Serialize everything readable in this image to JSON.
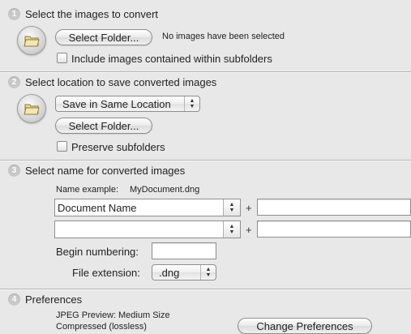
{
  "section1": {
    "number": "1",
    "title": "Select the images to convert",
    "select_folder_label": "Select Folder...",
    "status": "No images have been selected",
    "include_subfolders_label": "Include images contained within subfolders"
  },
  "section2": {
    "number": "2",
    "title": "Select location to save converted images",
    "location_value": "Save in Same Location",
    "select_folder_label": "Select Folder...",
    "preserve_subfolders_label": "Preserve subfolders"
  },
  "section3": {
    "number": "3",
    "title": "Select name for converted images",
    "name_example_label": "Name example:",
    "name_example_value": "MyDocument.dng",
    "name_part1_value": "Document Name",
    "name_part2_value": "",
    "plus": "+",
    "begin_numbering_label": "Begin numbering:",
    "begin_numbering_value": "",
    "file_extension_label": "File extension:",
    "file_extension_value": ".dng"
  },
  "section4": {
    "number": "4",
    "title": "Preferences",
    "line1": "JPEG Preview: Medium Size",
    "line2": "Compressed (lossless)",
    "change_prefs_label": "Change Preferences"
  },
  "icons": {
    "folder": "folder-icon",
    "popup_arrows": "up-down-arrows-icon"
  }
}
